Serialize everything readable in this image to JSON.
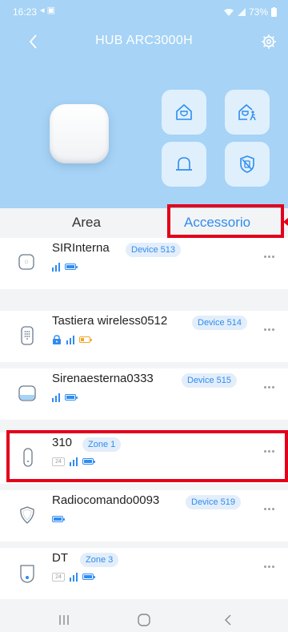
{
  "status_bar": {
    "time": "16:23",
    "battery": "73%"
  },
  "header": {
    "title": "HUB ARC3000H"
  },
  "quick_actions": [
    {
      "name": "arm-home-icon"
    },
    {
      "name": "arm-away-icon"
    },
    {
      "name": "alarm-bell-icon"
    },
    {
      "name": "disarm-shield-icon"
    }
  ],
  "tabs": [
    {
      "label": "Area",
      "active": false
    },
    {
      "label": "Accessorio",
      "active": true
    }
  ],
  "devices": [
    {
      "name": "SIRInterna",
      "badge": "Device 513",
      "icon": "indoor-siren-icon",
      "has_lock": false,
      "temp": "",
      "battery": "full",
      "signal": true
    },
    {
      "name": "Tastiera wireless0512",
      "badge": "Device 514",
      "icon": "keypad-icon",
      "has_lock": true,
      "temp": "",
      "battery": "low",
      "signal": true
    },
    {
      "name": "Sirenaesterna0333",
      "badge": "Device 515",
      "icon": "outdoor-siren-icon",
      "has_lock": false,
      "temp": "",
      "battery": "full",
      "signal": true
    },
    {
      "name": "310",
      "badge": "Zone 1",
      "icon": "door-sensor-icon",
      "has_lock": false,
      "temp": "24",
      "battery": "full",
      "signal": true
    },
    {
      "name": "Radiocomando0093",
      "badge": "Device 519",
      "icon": "remote-control-icon",
      "has_lock": false,
      "temp": "",
      "battery": "full",
      "signal": false
    },
    {
      "name": "DT",
      "badge": "Zone 3",
      "icon": "motion-detector-icon",
      "has_lock": false,
      "temp": "24",
      "battery": "full",
      "signal": true
    }
  ],
  "colors": {
    "header_bg": "#a6d3f6",
    "accent": "#2f8cf0",
    "highlight": "#e3001b",
    "battery_low": "#f5a623"
  }
}
